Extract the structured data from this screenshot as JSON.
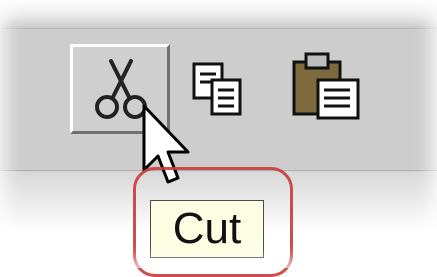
{
  "tooltip": {
    "text": "Cut"
  },
  "toolbar": {
    "buttons": [
      {
        "icon": "scissors-icon",
        "name": "cut",
        "state": "pressed"
      },
      {
        "icon": "copy-icon",
        "name": "copy",
        "state": "normal"
      },
      {
        "icon": "paste-icon",
        "name": "paste",
        "state": "normal"
      }
    ]
  },
  "colors": {
    "toolbar_bg": "#cdcdcd",
    "tooltip_bg": "#fdfde3",
    "highlight": "#c93a3a"
  }
}
